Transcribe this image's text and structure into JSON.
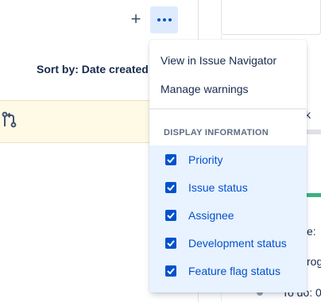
{
  "toolbar": {
    "add_label": "+",
    "more_icon": "more-horizontal-icon"
  },
  "sort": {
    "label": "Sort by: Date created"
  },
  "background": {
    "right_fragments": [
      "k",
      "e: ",
      "rog",
      "To do: 0"
    ]
  },
  "menu": {
    "items": [
      {
        "label": "View in Issue Navigator"
      },
      {
        "label": "Manage warnings"
      }
    ],
    "section_title": "DISPLAY INFORMATION",
    "options": [
      {
        "label": "Priority",
        "checked": true
      },
      {
        "label": "Issue status",
        "checked": true
      },
      {
        "label": "Assignee",
        "checked": true
      },
      {
        "label": "Development status",
        "checked": true
      },
      {
        "label": "Feature flag status",
        "checked": true
      }
    ]
  },
  "colors": {
    "accent": "#0052cc",
    "selected_bg": "#e9f2ff",
    "warning_bg": "#fffae6",
    "success": "#36b37e"
  }
}
